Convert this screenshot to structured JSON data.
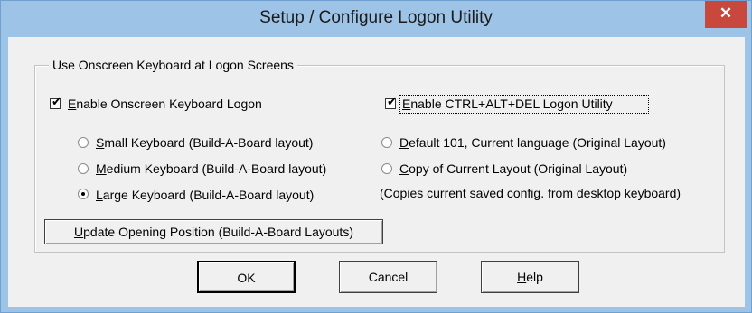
{
  "window": {
    "title": "Setup / Configure Logon Utility",
    "close_glyph": "✕"
  },
  "group": {
    "legend": "Use Onscreen Keyboard at Logon Screens"
  },
  "checkbox_osk": {
    "label_pre": "",
    "mnemonic": "E",
    "label_post": "nable Onscreen Keyboard Logon",
    "checked": true
  },
  "checkbox_cad": {
    "label_pre": "",
    "mnemonic": "E",
    "label_post": "nable CTRL+ALT+DEL Logon Utility",
    "checked": true
  },
  "radios_left": [
    {
      "mnemonic": "S",
      "rest": "mall Keyboard (Build-A-Board layout)",
      "selected": false
    },
    {
      "mnemonic": "M",
      "rest": "edium Keyboard (Build-A-Board layout)",
      "selected": false
    },
    {
      "mnemonic": "L",
      "rest": "arge Keyboard (Build-A-Board layout)",
      "selected": true
    }
  ],
  "radios_right": [
    {
      "mnemonic": "D",
      "rest": "efault 101, Current language (Original Layout)",
      "selected": false
    },
    {
      "mnemonic": "C",
      "rest": "opy of Current Layout (Original Layout)",
      "selected": false
    }
  ],
  "note": "(Copies current saved config. from desktop keyboard)",
  "update_button": {
    "mnemonic": "U",
    "rest": "pdate Opening Position (Build-A-Board Layouts)"
  },
  "buttons": {
    "ok": "OK",
    "cancel": "Cancel",
    "help_mnemonic": "H",
    "help_rest": "elp"
  },
  "colors": {
    "title_bg": "#9dc3e6",
    "close_bg": "#c9483d",
    "client_bg": "#f0f0f0"
  }
}
